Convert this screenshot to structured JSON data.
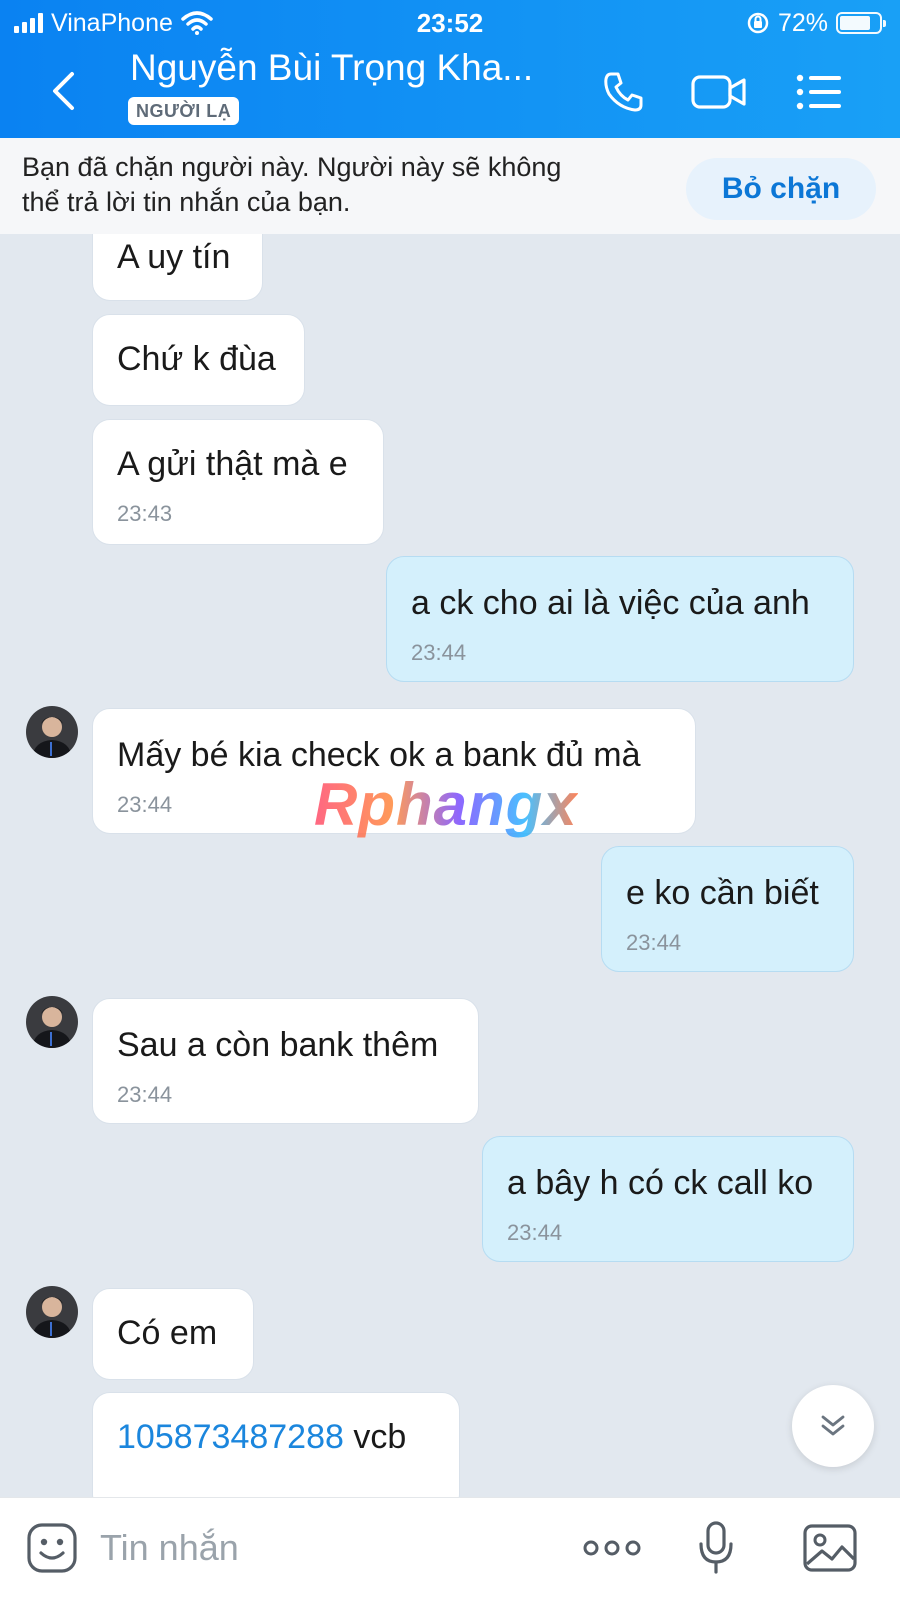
{
  "status_bar": {
    "carrier": "VinaPhone",
    "time": "23:52",
    "battery": "72%",
    "battery_level": 0.72
  },
  "header": {
    "contact_name": "Nguyễn Bùi Trọng Kha...",
    "badge": "NGƯỜI LẠ",
    "icons": [
      "back-icon",
      "phone-icon",
      "video-call-icon",
      "menu-list-icon"
    ]
  },
  "banner": {
    "line1": "Bạn đã chặn người này. Người này sẽ không",
    "line2": "thể trả lời tin nhắn của bạn.",
    "unblock_label": "Bỏ chặn"
  },
  "messages": [
    {
      "dir": "in",
      "text": "A uy tín"
    },
    {
      "dir": "in",
      "text": "Chứ k đùa"
    },
    {
      "dir": "in",
      "text": "A gửi thật mà e",
      "time": "23:43"
    },
    {
      "dir": "out",
      "text": "a ck cho ai là việc của anh",
      "time": "23:44"
    },
    {
      "dir": "in",
      "text": "Mấy bé kia check ok a bank đủ mà",
      "time": "23:44",
      "avatar": true
    },
    {
      "dir": "out",
      "text": "e ko cần biết",
      "time": "23:44"
    },
    {
      "dir": "in",
      "text": "Sau a còn bank thêm",
      "time": "23:44",
      "avatar": true
    },
    {
      "dir": "out",
      "text": "a bây h có ck call ko",
      "time": "23:44"
    },
    {
      "dir": "in",
      "text": "Có em",
      "avatar": true
    },
    {
      "dir": "in",
      "link": "105873487288",
      "text": " vcb"
    }
  ],
  "watermark": "Rphangx",
  "input_bar": {
    "placeholder": "Tin nhắn",
    "icons": [
      "sticker-icon",
      "more-icon",
      "microphone-icon",
      "image-icon"
    ]
  },
  "colors": {
    "header_start": "#0a82f2",
    "header_end": "#19a0f6",
    "chat_background": "#e2e8ef",
    "incoming_bubble": "#ffffff",
    "outgoing_bubble": "#d4f0fc",
    "link": "#1b86dd",
    "unblock_text": "#0c77d6"
  }
}
